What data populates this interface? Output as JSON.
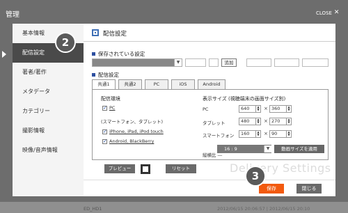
{
  "modal": {
    "title": "管理",
    "close_label": "CLOSE"
  },
  "sidebar": {
    "items": [
      {
        "label": "基本情報"
      },
      {
        "label": "配信設定"
      },
      {
        "label": "著者/著作"
      },
      {
        "label": "メタデータ"
      },
      {
        "label": "カテゴリー"
      },
      {
        "label": "撮影情報"
      },
      {
        "label": "映像/音声情報"
      }
    ],
    "active_index": 1
  },
  "steps": {
    "step1": "2",
    "step2": "3"
  },
  "content": {
    "header_title": "配信設定",
    "saved_section": "保存されている設定",
    "add_button": "追加",
    "delivery_section": "配信設定",
    "tabs": [
      "共通1",
      "共通2",
      "PC",
      "iOS",
      "Android"
    ],
    "active_tab": 0,
    "env_title": "配信環境",
    "env_pc": "PC",
    "env_note": "(スマートフォン、タブレット)",
    "env_ios": "iPhone, iPad, iPod touch",
    "env_android": "Android, BlackBerry",
    "size_title": "表示サイズ (視聴端末の画面サイズ別)",
    "sizes": [
      {
        "label": "PC",
        "w": "640",
        "h": "360"
      },
      {
        "label": "タブレット",
        "w": "480",
        "h": "270"
      },
      {
        "label": "スマートフォン",
        "w": "160",
        "h": "90"
      }
    ],
    "times_sign": "×",
    "ratio_label": "縦横比 ―",
    "ratio_value": "16 : 9",
    "apply_button": "動画サイズを適用",
    "preview_button": "プレビュー",
    "reset_button": "リセット",
    "watermark": "Delivery Settings",
    "save_button": "保存",
    "close_button": "閉じる"
  },
  "background": {
    "row_label": "ED_HD1",
    "row_dates": "2012/06/15 20:06:57  |  2012/06/15 20:10"
  },
  "colors": {
    "accent": "#f25a0f",
    "section_square": "#2d4fa0",
    "overlay": "#6d6d6d"
  }
}
